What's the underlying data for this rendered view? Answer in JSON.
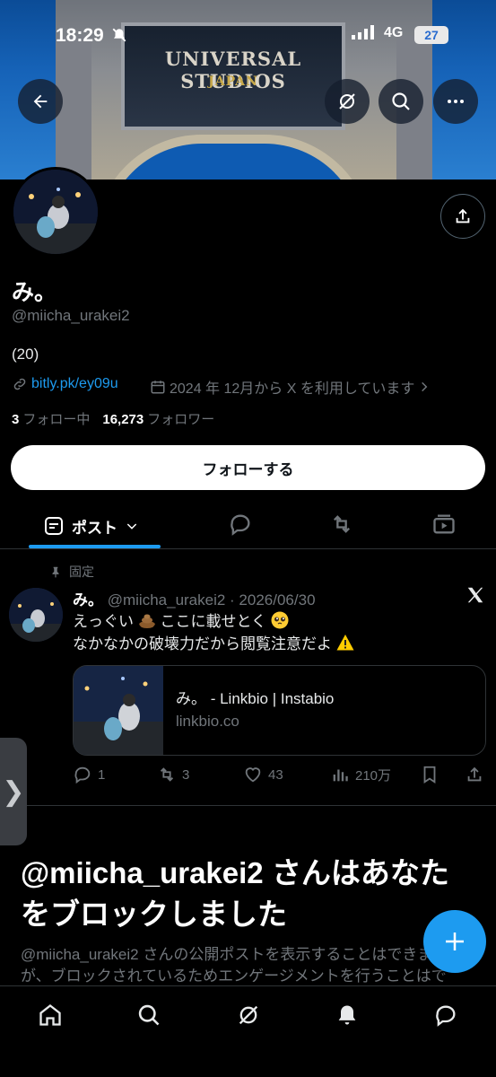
{
  "status": {
    "time": "18:29",
    "network": "4G",
    "battery": "27"
  },
  "banner": {
    "sign_line1": "UNIVERSAL STUDIOS",
    "sign_line2": "JAPAN"
  },
  "profile": {
    "name": "み。",
    "handle": "@miicha_urakei2",
    "bio": "(20)",
    "link": "bitly.pk/ey09u",
    "joined": "2024 年 12月から X を利用しています",
    "following_count": "3",
    "following_label": "フォロー中",
    "followers_count": "16,273",
    "followers_label": "フォロワー",
    "follow_button": "フォローする"
  },
  "tabs": {
    "active_label": "ポスト"
  },
  "post": {
    "pinned_label": "固定",
    "author": "み。",
    "handle_date": "@miicha_urakei2 · 2026/06/30",
    "line1_a": "えっぐい",
    "line1_b": "ここに載せとく",
    "line2": "なかなかの破壊力だから閲覧注意だよ",
    "card_title": "み。 - Linkbio | Instabio",
    "card_domain": "linkbio.co",
    "replies": "1",
    "reposts": "3",
    "likes": "43",
    "views": "210万"
  },
  "block": {
    "title": "@miicha_urakei2 さんはあなたをブロックしました",
    "body": "@miicha_urakei2 さんの公開ポストを表示することはできますが、ブロックされているためエンゲージメントを行うことはできません。"
  },
  "side_tab": {
    "glyph": "❯"
  },
  "colors": {
    "accent": "#1d9bf0",
    "background": "#000000",
    "muted": "#71767b"
  }
}
